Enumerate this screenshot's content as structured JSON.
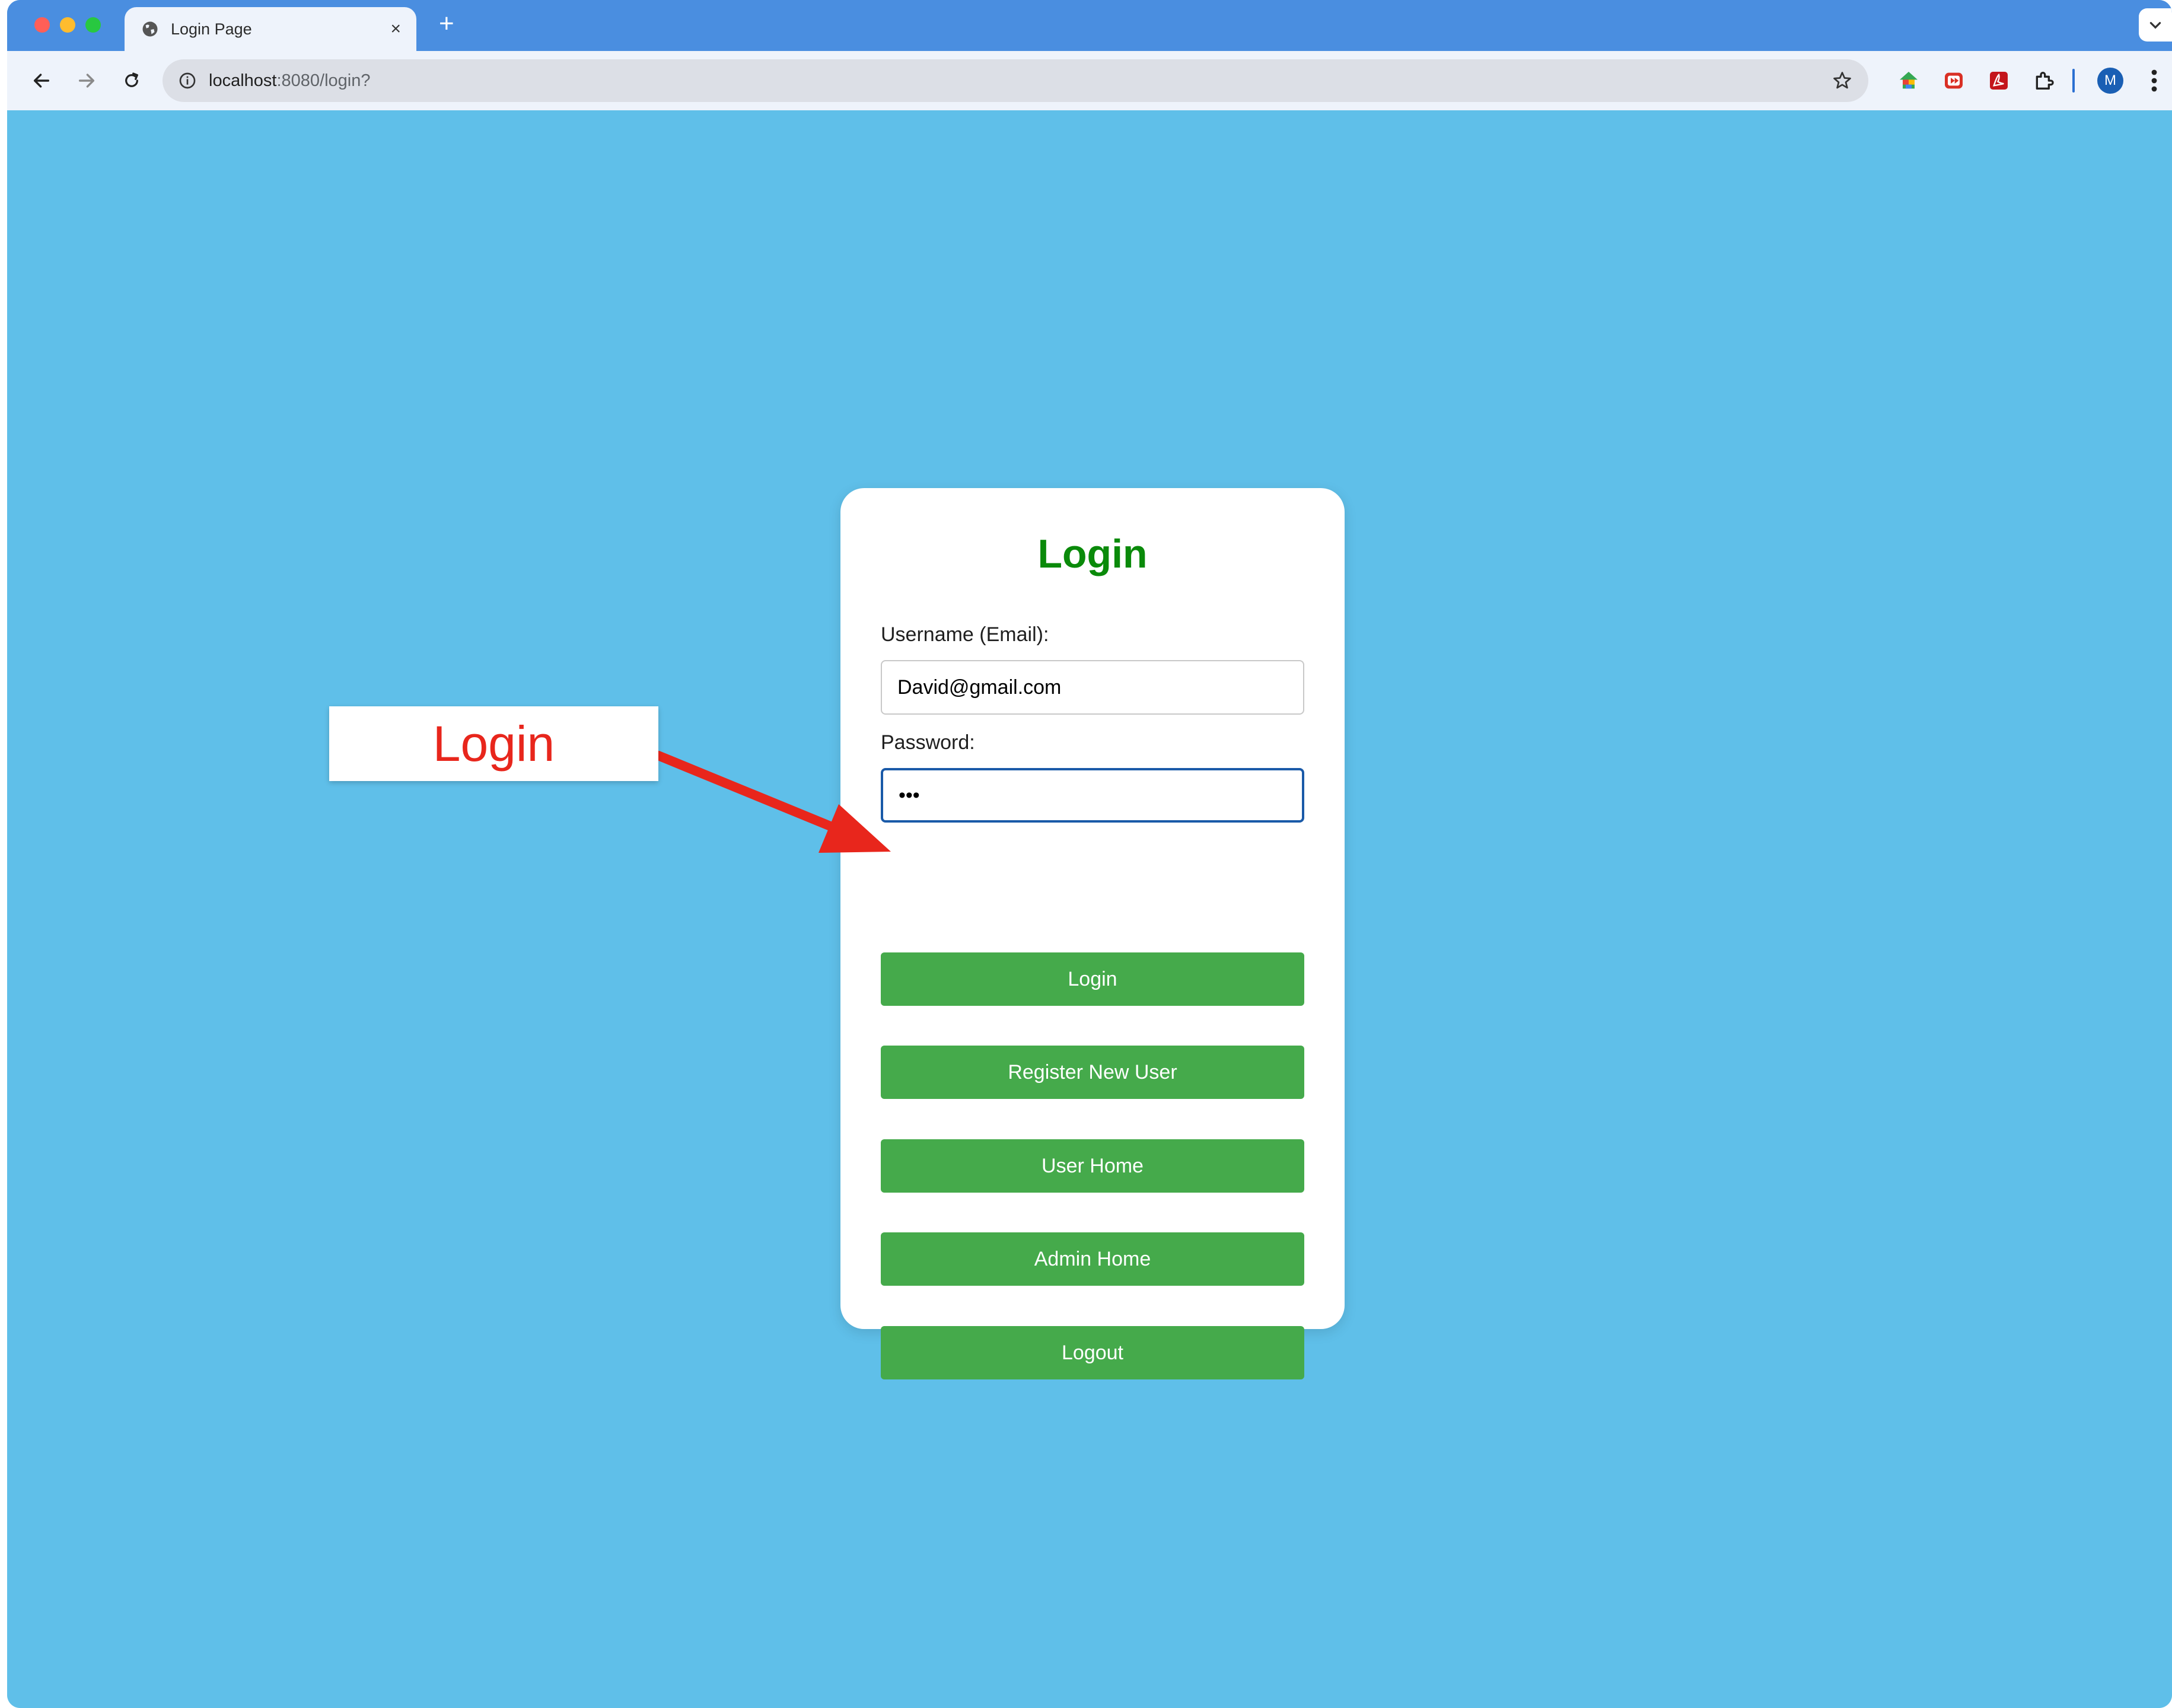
{
  "browser": {
    "tab_title": "Login Page",
    "tab_close": "×",
    "new_tab": "+",
    "url_host": "localhost",
    "url_path": ":8080/login?",
    "profile_initial": "M"
  },
  "login_card": {
    "title": "Login",
    "username_label": "Username (Email):",
    "username_value": "David@gmail.com",
    "password_label": "Password:",
    "password_value": "•••",
    "buttons": {
      "login": "Login",
      "register": "Register New User",
      "user_home": "User Home",
      "admin_home": "Admin Home",
      "logout": "Logout"
    }
  },
  "annotation": {
    "callout_text": "Login",
    "color": "#e8261c"
  },
  "colors": {
    "page_background": "#5fbfe9",
    "button_green": "#45aa4b",
    "title_green": "#0a8a0a",
    "tabstrip_blue": "#4a8ee0"
  }
}
